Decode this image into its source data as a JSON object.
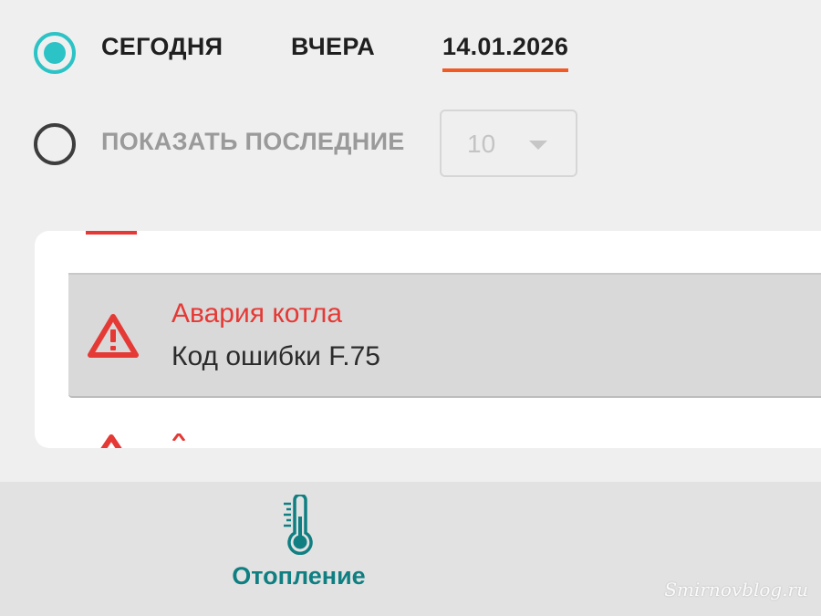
{
  "filters": {
    "today_label": "СЕГОДНЯ",
    "yesterday_label": "ВЧЕРА",
    "date_label": "14.01.2026",
    "show_last_label": "ПОКАЗАТЬ ПОСЛЕДНИЕ",
    "show_last_value": "10",
    "selected": "today",
    "accent_color": "#f15a24",
    "radio_color": "#2cc3c6"
  },
  "events": {
    "items": [
      {
        "title": "Авария котла",
        "subtitle": "Код ошибки F.75",
        "icon": "warning-triangle-icon",
        "title_color": "#e53935"
      }
    ]
  },
  "bottom_nav": {
    "items": [
      {
        "label": "Отопление",
        "icon": "thermometer-icon",
        "color": "#0f7f82"
      }
    ]
  },
  "watermark": "Smirnovblog.ru"
}
